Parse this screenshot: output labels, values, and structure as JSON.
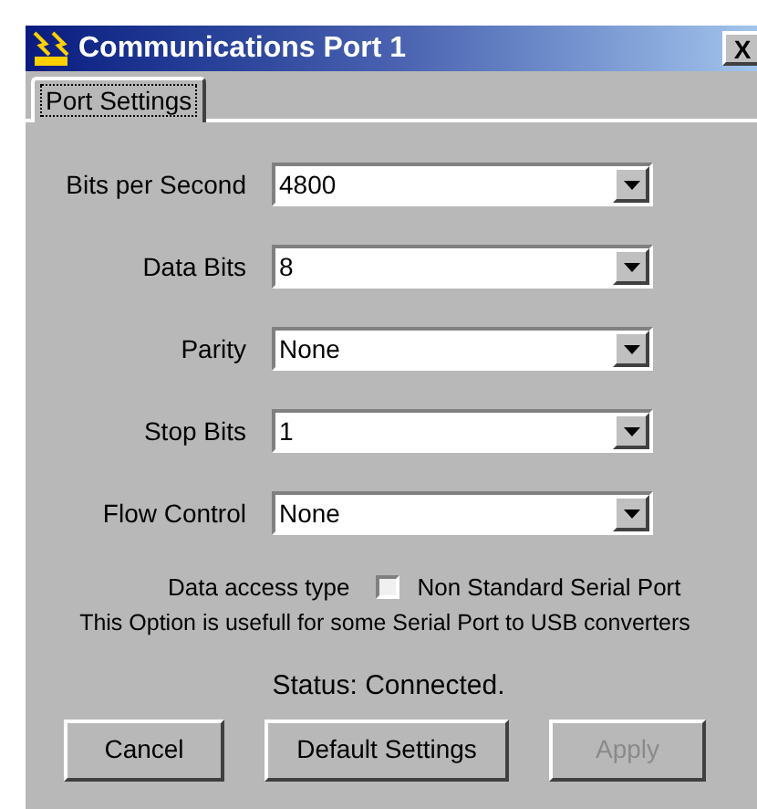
{
  "window": {
    "title": "Communications Port 1",
    "close": "X"
  },
  "tabs": [
    {
      "label": "Port Settings",
      "selected": true
    }
  ],
  "fields": [
    {
      "label": "Bits per Second",
      "value": "4800"
    },
    {
      "label": "Data Bits",
      "value": "8"
    },
    {
      "label": "Parity",
      "value": "None"
    },
    {
      "label": "Stop Bits",
      "value": "1"
    },
    {
      "label": "Flow Control",
      "value": "None"
    }
  ],
  "data_access": {
    "label": "Data access type",
    "option": "Non Standard Serial Port",
    "checked": false
  },
  "note": "This Option is usefull for some Serial Port to USB converters",
  "status": "Status: Connected.",
  "buttons": [
    {
      "label": "Cancel",
      "disabled": false
    },
    {
      "label": "Default Settings",
      "disabled": false
    },
    {
      "label": "Apply",
      "disabled": true
    }
  ]
}
